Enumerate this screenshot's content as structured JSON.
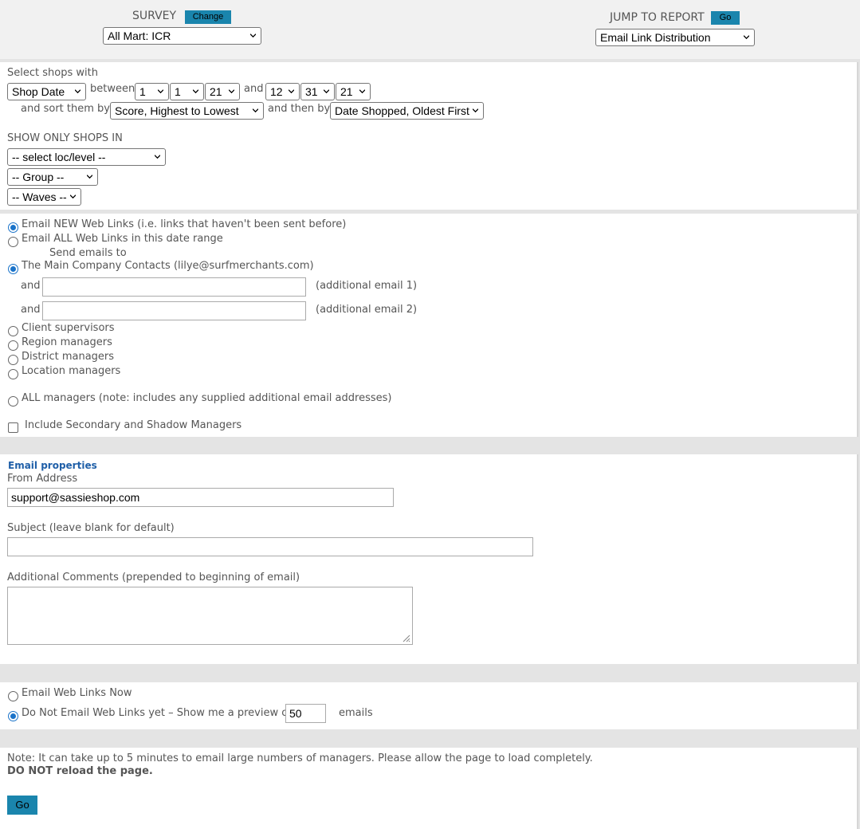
{
  "header": {
    "survey_label": "SURVEY",
    "change_button": "Change",
    "survey_select": "All Mart: ICR",
    "jump_label": "JUMP TO REPORT",
    "go_button": "Go",
    "report_select": "Email Link Distribution"
  },
  "filter": {
    "select_shops_label": "Select shops with",
    "date_type": "Shop Date",
    "between_label": "between",
    "start_month": "1",
    "start_day": "1",
    "start_year": "21",
    "and_label": "and",
    "end_month": "12",
    "end_day": "31",
    "end_year": "21",
    "sort_label": "and sort them by",
    "sort_primary": "Score, Highest to Lowest",
    "then_by_label": "and then by",
    "sort_secondary": "Date Shopped, Oldest First",
    "show_only_label": "SHOW ONLY SHOPS IN",
    "loc_level": "-- select loc/level --",
    "group": "-- Group --",
    "waves": "-- Waves --"
  },
  "recipients": {
    "email_new": "Email NEW Web Links (i.e. links that haven't been sent before)",
    "email_all": "Email ALL Web Links in this date range",
    "send_to_label": "Send emails to",
    "main_contacts": "The Main Company Contacts (lilye@surfmerchants.com)",
    "and_label_1": "and",
    "additional_email_1_label": "(additional email 1)",
    "and_label_2": "and",
    "additional_email_2_label": "(additional email 2)",
    "client_supervisors": "Client supervisors",
    "region_managers": "Region managers",
    "district_managers": "District managers",
    "location_managers": "Location managers",
    "all_managers": "ALL managers (note: includes any supplied additional email addresses)",
    "include_secondary": "Include Secondary and Shadow Managers"
  },
  "email_properties": {
    "heading": "Email properties",
    "from_label": "From Address",
    "from_value": "support@sassieshop.com",
    "subject_label": "Subject (leave blank for default)",
    "subject_value": "",
    "comments_label": "Additional Comments (prepended to beginning of email)"
  },
  "send": {
    "email_now": "Email Web Links Now",
    "preview_label": "Do Not Email Web Links yet – Show me a preview of",
    "preview_count": "50",
    "emails_label": "emails"
  },
  "footer": {
    "note": "Note: It can take up to 5 minutes to email large numbers of managers. Please allow the page to load completely.",
    "warning": "DO NOT reload the page.",
    "go_button": "Go"
  },
  "colors": {
    "accent": "#1a85ad",
    "heading": "#1f5fa8",
    "radio_selected": "#1a73c9"
  }
}
